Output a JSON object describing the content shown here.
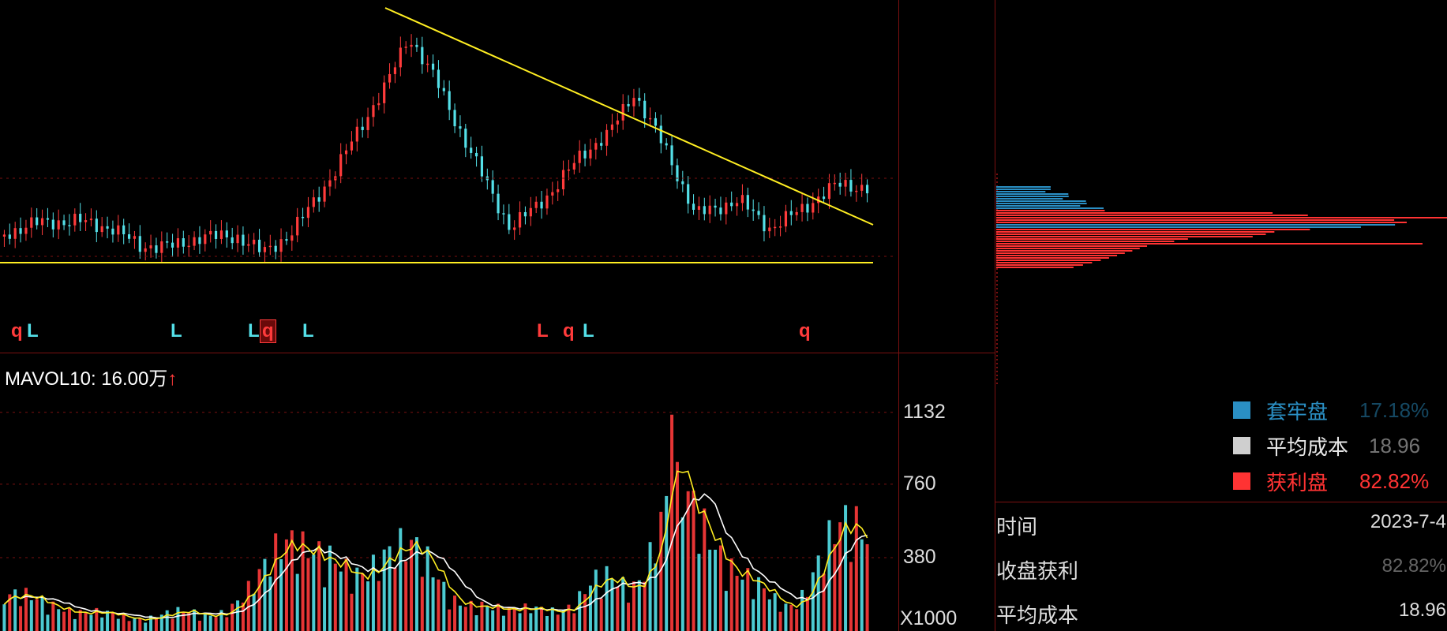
{
  "colors": {
    "up": "#ff3b3b",
    "down": "#54e0e8",
    "trend": "#ffee22",
    "grid": "#7a1010",
    "ma_fast": "#ffee22",
    "ma_slow": "#ffffff",
    "trapped": "#2a8fc4",
    "average_cost": "#cfcfcf",
    "profit": "#ff3333"
  },
  "signals": [
    {
      "text": "q",
      "kind": "q"
    },
    {
      "text": "L",
      "kind": "L"
    },
    {
      "text": "L",
      "kind": "L"
    },
    {
      "text": "L",
      "kind": "L"
    },
    {
      "text": "q",
      "kind": "qbox"
    },
    {
      "text": "L",
      "kind": "L"
    },
    {
      "text": "L",
      "kind": "Lred"
    },
    {
      "text": "q",
      "kind": "q"
    },
    {
      "text": "L",
      "kind": "L"
    },
    {
      "text": "q",
      "kind": "q"
    }
  ],
  "volume_panel": {
    "indicator_label": "MAVOL10: 16.00万",
    "arrow": "↑",
    "scale_label": "X1000"
  },
  "chart_data": [
    {
      "type": "candlestick",
      "title": "",
      "trendlines": [
        "descending resistance",
        "horizontal support"
      ],
      "candles": []
    },
    {
      "type": "bar",
      "title": "MAVOL10: 16.00万",
      "yticks": [
        1132,
        760,
        380
      ],
      "unit": "X1000",
      "series": [
        {
          "values": []
        },
        {
          "values": []
        },
        {
          "values": []
        }
      ]
    }
  ],
  "chip_distribution": {
    "legend": [
      {
        "label": "套牢盘",
        "value": "17.18%",
        "color_key": "trapped"
      },
      {
        "label": "平均成本",
        "value": "18.96",
        "color_key": "average_cost"
      },
      {
        "label": "获利盘",
        "value": "82.82%",
        "color_key": "profit"
      }
    ],
    "info": [
      {
        "label": "时间",
        "value": "2023-7-4"
      },
      {
        "label": "收盘获利",
        "value": "82.82%"
      },
      {
        "label": "平均成本",
        "value": "18.96"
      }
    ]
  }
}
